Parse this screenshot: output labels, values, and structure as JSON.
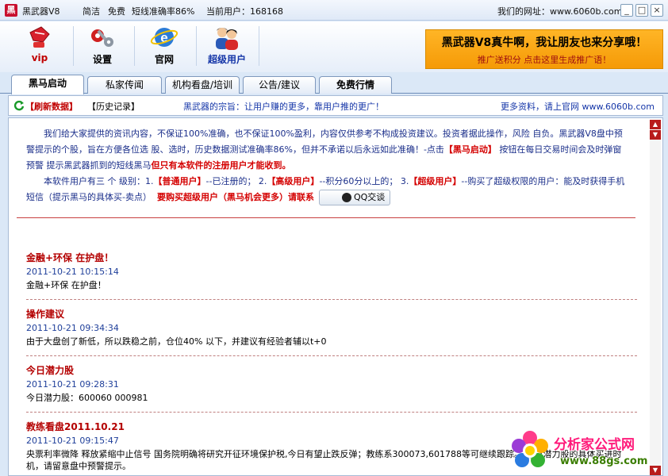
{
  "titlebar": {
    "app_name": "黑武器V8",
    "mode": "简洁",
    "free": "免费",
    "accuracy": "短线准确率86%",
    "current_user_label": "当前用户：168168",
    "website_label": "我们的网址：www.6060b.com",
    "minimize": "_",
    "restore": "□",
    "close": "×"
  },
  "toolbar": {
    "vip": "vip",
    "settings": "设置",
    "official": "官网",
    "super_user": "超级用户"
  },
  "banner": {
    "line1": "黑武器V8真牛啊，我让朋友也来分享哦！",
    "line2": "推广送积分  点击这里生成推广语！"
  },
  "tabs": [
    "黑马启动",
    "私家传闻",
    "机构看盘/培训",
    "公告/建议",
    "免费行情"
  ],
  "subbar": {
    "refresh": "【刷新数据】",
    "history": "【历史记录】",
    "motto": "黑武器的宗旨：让用户赚的更多，靠用户推的更广！",
    "more": "更多资料，请上官网 www.6060b.com"
  },
  "intro": {
    "p1a": "我们给大家提供的资讯内容，不保证100%准确，也不保证100%盈利，内容仅供参考不构成投资建议。投资者据此操作，风险 自负。黑武器V8盘中预警提示的个股，旨在方便各位选 股、选时，历史数据测试准确率86%，但并不承诺以后永远如此准确！-点击",
    "p1b": "【黑马启动】",
    "p1c": " 按钮在每日交易时间会及时弹窗预警 提示黑武器抓到的短线黑马",
    "p1d": "但只有本软件的注册用户才能收到。",
    "p2a": "本软件用户有三 个 级别：1.",
    "p2b": "【普通用户】",
    "p2c": "--已注册的；  2.",
    "p2d": "【高级用户】",
    "p2e": "--积分60分以上的；   3.",
    "p2f": "【超级用户】",
    "p2g": "--购买了超级权限的用户：能及时获得手机短信（提示黑马的具体买-卖点）",
    "p2h": "要购买超级用户（黑马机会更多）请联系",
    "qq": "QQ交谈"
  },
  "news": [
    {
      "title": "金融+环保  在护盘！",
      "date": "2011-10-21  10:15:14",
      "body": "金融+环保  在护盘！"
    },
    {
      "title": "操作建议",
      "date": "2011-10-21  09:34:34",
      "body": "由于大盘创了新低，所以跌稳之前，仓位40% 以下，并建议有经验者辅以t+0"
    },
    {
      "title": "今日潜力股",
      "date": "2011-10-21  09:28:31",
      "body": "今日潜力股：600060 000981"
    },
    {
      "title": "教练看盘2011.10.21",
      "date": "2011-10-21  09:15:47",
      "body": "央票利率微降  释放紧缩中止信号 国务院明确将研究开征环境保护税,今日有望止跌反弹；教练系300073,601788等可继续跟踪。  今日潜力股的具体买进时机，请留意盘中预警提示。"
    }
  ],
  "watermark": {
    "line1": "分析家公式网",
    "line2": "www.88gs.com"
  },
  "colors": {
    "accent_red": "#b40000",
    "banner_orange": "#f7a512",
    "link_blue": "#1f3f9a"
  }
}
